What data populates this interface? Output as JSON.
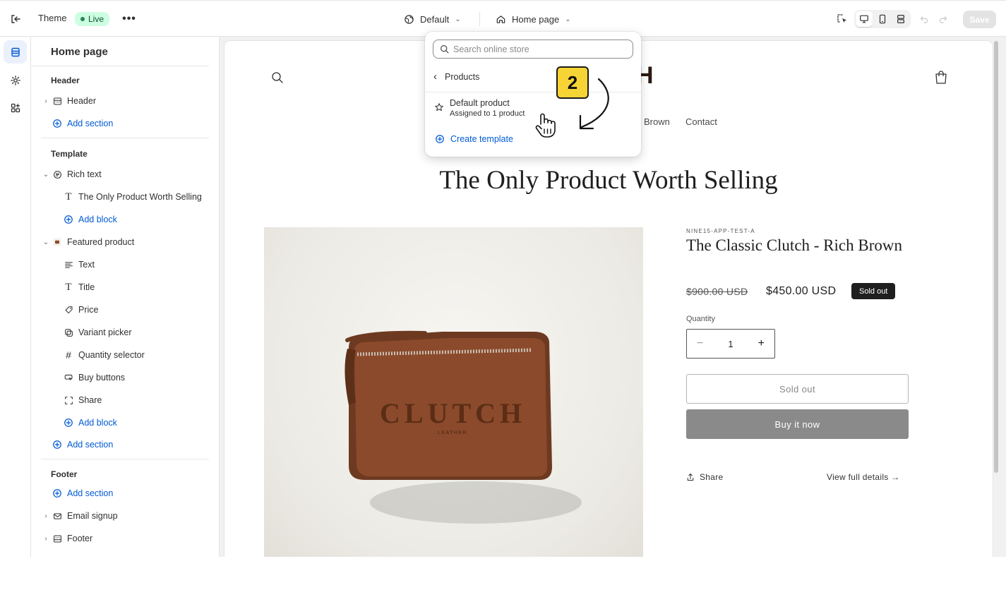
{
  "topbar": {
    "theme_label": "Theme",
    "live_label": "Live",
    "more_label": "•••",
    "theme_select_value": "Default",
    "page_select_value": "Home page",
    "save_label": "Save"
  },
  "sidebar": {
    "title": "Home page",
    "groups": {
      "header": "Header",
      "template": "Template",
      "footer": "Footer"
    },
    "items": {
      "header": "Header",
      "header_add_section": "Add section",
      "rich_text": "Rich text",
      "rich_text_heading": "The Only Product Worth Selling",
      "rich_text_add_block": "Add block",
      "featured_product": "Featured product",
      "text": "Text",
      "title": "Title",
      "price": "Price",
      "variant_picker": "Variant picker",
      "quantity_selector": "Quantity selector",
      "buy_buttons": "Buy buttons",
      "share": "Share",
      "featured_add_block": "Add block",
      "template_add_section": "Add section",
      "footer_add_section": "Add section",
      "email_signup": "Email signup",
      "footer": "Footer"
    }
  },
  "popover": {
    "search_placeholder": "Search online store",
    "back_label": "Products",
    "item_title": "Default product",
    "item_subtitle": "Assigned to 1 product",
    "create_label": "Create template"
  },
  "preview": {
    "logo_text": "H",
    "nav": [
      "Brown",
      "Contact"
    ],
    "headline": "The Only Product Worth Selling",
    "product_image_text": "CLUTCH",
    "product_image_subtext": "LEATHER",
    "vendor": "NINE15-APP-TEST-A",
    "product_title": "The Classic Clutch - Rich Brown",
    "price_compare": "$900.00 USD",
    "price": "$450.00 USD",
    "badge": "Sold out",
    "quantity_label": "Quantity",
    "quantity_value": "1",
    "qty_minus": "−",
    "qty_plus": "+",
    "soldout_button": "Sold out",
    "buy_button": "Buy it now",
    "share_label": "Share",
    "details_label": "View full details →"
  },
  "annotation": {
    "step_number": "2"
  },
  "colors": {
    "accent_blue": "#005bd3",
    "live_bg": "#cdfee1",
    "badge_yellow": "#f7d436",
    "buy_button_gray": "#8a8a8a"
  }
}
